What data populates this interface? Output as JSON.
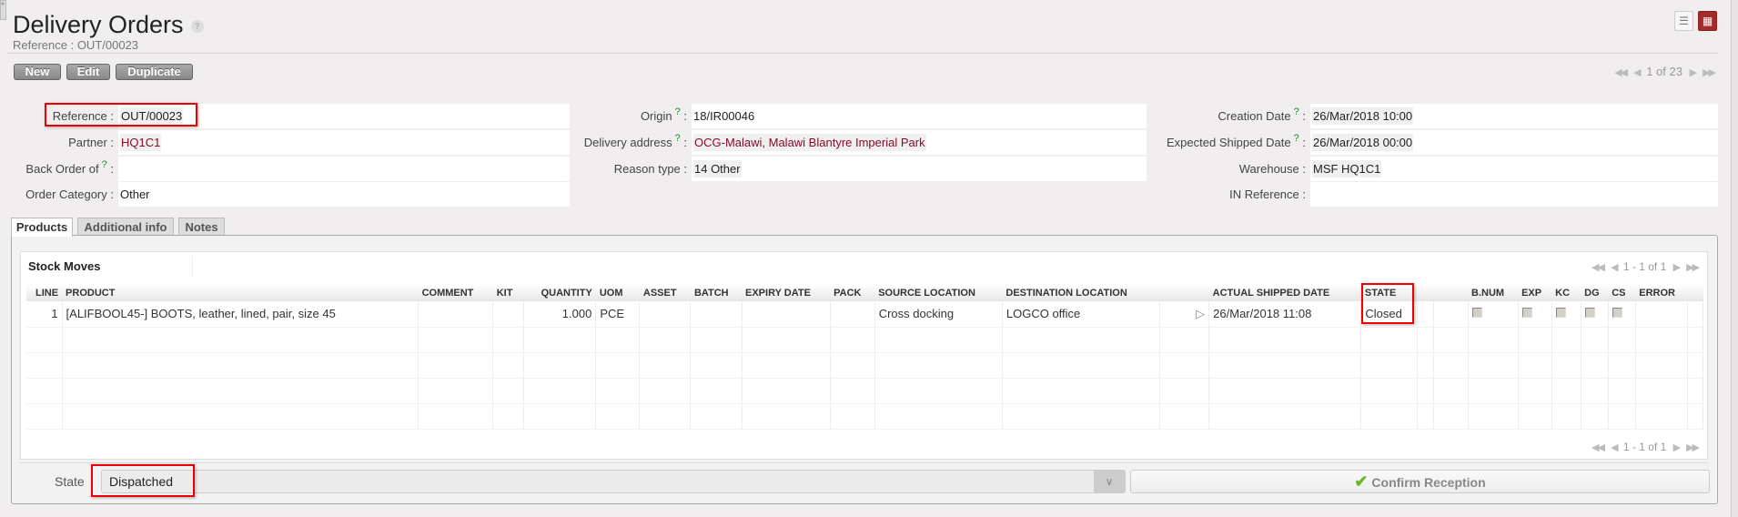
{
  "header": {
    "title": "Delivery Orders",
    "help": "?",
    "subtitle": "Reference : OUT/00023"
  },
  "toolbar": {
    "new": "New",
    "edit": "Edit",
    "duplicate": "Duplicate",
    "pager": "1 of 23",
    "view_list": "list-view-icon",
    "view_form": "form-view-icon"
  },
  "form": {
    "reference": {
      "label": "Reference :",
      "value": "OUT/00023"
    },
    "partner": {
      "label": "Partner :",
      "value": "HQ1C1"
    },
    "back_order": {
      "label": "Back Order of",
      "value": ""
    },
    "order_category": {
      "label": "Order Category :",
      "value": "Other"
    },
    "origin": {
      "label": "Origin",
      "value": "18/IR00046"
    },
    "delivery_address": {
      "label": "Delivery address",
      "value": "OCG-Malawi, Malawi Blantyre Imperial Park"
    },
    "reason_type": {
      "label": "Reason type :",
      "value": "14 Other"
    },
    "creation_date": {
      "label": "Creation Date",
      "value": "26/Mar/2018 10:00"
    },
    "expected_shipped_date": {
      "label": "Expected Shipped Date",
      "value": "26/Mar/2018 00:00"
    },
    "warehouse": {
      "label": "Warehouse :",
      "value": "MSF HQ1C1"
    },
    "in_reference": {
      "label": "IN Reference :",
      "value": ""
    },
    "help_mark": "?",
    "colon": ":"
  },
  "tabs": [
    "Products",
    "Additional info",
    "Notes"
  ],
  "stock_moves": {
    "title": "Stock Moves",
    "pager": "1 - 1 of 1",
    "columns": [
      "LINE",
      "PRODUCT",
      "COMMENT",
      "KIT",
      "QUANTITY",
      "UOM",
      "ASSET",
      "BATCH",
      "EXPIRY DATE",
      "PACK",
      "SOURCE LOCATION",
      "DESTINATION LOCATION",
      "",
      "ACTUAL SHIPPED DATE",
      "STATE",
      "",
      "",
      "B.NUM",
      "EXP",
      "KC",
      "DG",
      "CS",
      "ERROR",
      ""
    ],
    "rows": [
      {
        "line": "1",
        "product": "[ALIFBOOL45-] BOOTS, leather, lined, pair, size 45",
        "quantity": "1.000",
        "uom": "PCE",
        "source": "Cross docking",
        "destination": "LOGCO office",
        "actual_shipped_date": "26/Mar/2018 11:08",
        "state": "Closed"
      }
    ]
  },
  "footer": {
    "state_label": "State",
    "state_value": "Dispatched",
    "confirm": "Confirm Reception"
  }
}
